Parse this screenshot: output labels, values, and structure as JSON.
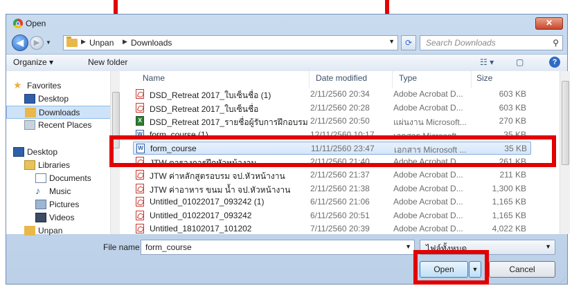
{
  "window": {
    "title": "Open",
    "close_label": "✕"
  },
  "nav": {
    "back_icon": "arrow-left-icon",
    "forward_icon": "arrow-right-icon",
    "breadcrumbs": [
      "Unpan",
      "Downloads"
    ],
    "search_placeholder": "Search Downloads"
  },
  "toolbar": {
    "organize_label": "Organize ▾",
    "new_folder_label": "New folder"
  },
  "sidebar": {
    "items": [
      {
        "label": "Favorites",
        "icon": "star-icon"
      },
      {
        "label": "Desktop",
        "icon": "desktop-icon"
      },
      {
        "label": "Downloads",
        "icon": "downloads-folder-icon",
        "selected": true
      },
      {
        "label": "Recent Places",
        "icon": "recent-places-icon"
      },
      {
        "label": "Desktop",
        "icon": "desktop-icon"
      },
      {
        "label": "Libraries",
        "icon": "libraries-icon"
      },
      {
        "label": "Documents",
        "icon": "documents-icon"
      },
      {
        "label": "Music",
        "icon": "music-icon"
      },
      {
        "label": "Pictures",
        "icon": "pictures-icon"
      },
      {
        "label": "Videos",
        "icon": "videos-icon"
      },
      {
        "label": "Unpan",
        "icon": "user-folder-icon"
      }
    ]
  },
  "columns": {
    "name": "Name",
    "date": "Date modified",
    "type": "Type",
    "size": "Size"
  },
  "files": [
    {
      "name": "DSD_Retreat 2017_ใบเซ็นชื่อ (1)",
      "date": "2/11/2560 20:34",
      "type": "Adobe Acrobat D...",
      "size": "603 KB",
      "icon": "pdf"
    },
    {
      "name": "DSD_Retreat 2017_ใบเซ็นชื่อ",
      "date": "2/11/2560 20:28",
      "type": "Adobe Acrobat D...",
      "size": "603 KB",
      "icon": "pdf"
    },
    {
      "name": "DSD_Retreat 2017_รายชื่อผู้รับการฝึกอบรม",
      "date": "2/11/2560 20:50",
      "type": "แผ่นงาน Microsoft...",
      "size": "270 KB",
      "icon": "xls"
    },
    {
      "name": "form_course (1)",
      "date": "12/11/2560 10:17",
      "type": "เอกสาร Microsoft ...",
      "size": "35 KB",
      "icon": "doc"
    },
    {
      "name": "form_course",
      "date": "11/11/2560 23:47",
      "type": "เอกสาร Microsoft ...",
      "size": "35 KB",
      "icon": "doc",
      "selected": true
    },
    {
      "name": "JTW ตารางการฝึกหัวหน้างาน",
      "date": "2/11/2560 21:40",
      "type": "Adobe Acrobat D...",
      "size": "261 KB",
      "icon": "pdf"
    },
    {
      "name": "JTW ค่าหลักสูตรอบรม จป.หัวหน้างาน",
      "date": "2/11/2560 21:37",
      "type": "Adobe Acrobat D...",
      "size": "211 KB",
      "icon": "pdf"
    },
    {
      "name": "JTW ค่าอาหาร ขนม น้ำ จป.หัวหน้างาน",
      "date": "2/11/2560 21:38",
      "type": "Adobe Acrobat D...",
      "size": "1,300 KB",
      "icon": "pdf"
    },
    {
      "name": "Untitled_01022017_093242 (1)",
      "date": "6/11/2560 21:06",
      "type": "Adobe Acrobat D...",
      "size": "1,165 KB",
      "icon": "pdf"
    },
    {
      "name": "Untitled_01022017_093242",
      "date": "6/11/2560 20:51",
      "type": "Adobe Acrobat D...",
      "size": "1,165 KB",
      "icon": "pdf"
    },
    {
      "name": "Untitled_18102017_101202",
      "date": "7/11/2560 20:39",
      "type": "Adobe Acrobat D...",
      "size": "4,022 KB",
      "icon": "pdf"
    }
  ],
  "footer": {
    "filename_label": "File name:",
    "filename_value": "form_course",
    "filetype_value": "ไฟล์ทั้งหมด",
    "open_label": "Open",
    "cancel_label": "Cancel"
  },
  "colors": {
    "highlight": "#e30000",
    "selection": "#cfe3f8",
    "accent": "#2a6cc8"
  }
}
